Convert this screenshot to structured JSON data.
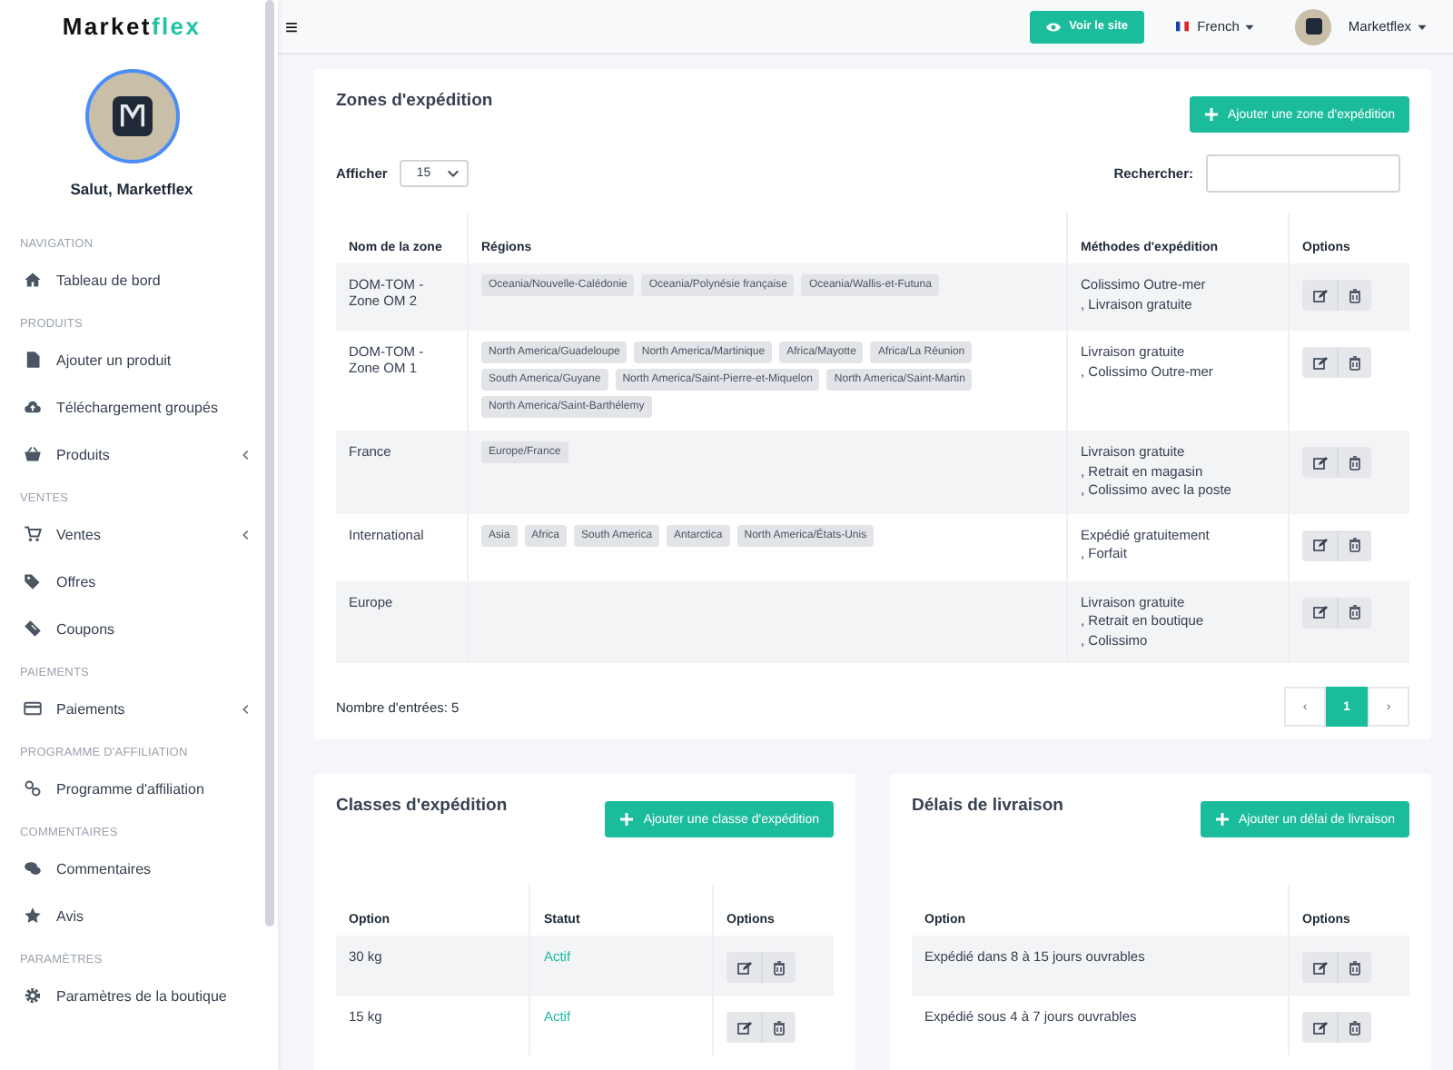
{
  "sidebar": {
    "logo": {
      "dark": "Market",
      "accent": "flex"
    },
    "greeting": "Salut, Marketflex",
    "menu": [
      {
        "kind": "section",
        "label": "NAVIGATION"
      },
      {
        "kind": "item",
        "label": "Tableau de bord",
        "submenu": false
      },
      {
        "kind": "section",
        "label": "PRODUITS"
      },
      {
        "kind": "item",
        "label": "Ajouter un produit",
        "submenu": false
      },
      {
        "kind": "item",
        "label": "Téléchargement groupés",
        "submenu": false
      },
      {
        "kind": "item",
        "label": "Produits",
        "submenu": true
      },
      {
        "kind": "section",
        "label": "VENTES"
      },
      {
        "kind": "item",
        "label": "Ventes",
        "submenu": true
      },
      {
        "kind": "item",
        "label": "Offres",
        "submenu": false
      },
      {
        "kind": "item",
        "label": "Coupons",
        "submenu": false
      },
      {
        "kind": "section",
        "label": "PAIEMENTS"
      },
      {
        "kind": "item",
        "label": "Paiements",
        "submenu": true
      },
      {
        "kind": "section",
        "label": "PROGRAMME D'AFFILIATION"
      },
      {
        "kind": "item",
        "label": "Programme d'affiliation",
        "submenu": false
      },
      {
        "kind": "section",
        "label": "COMMENTAIRES"
      },
      {
        "kind": "item",
        "label": "Commentaires",
        "submenu": false
      },
      {
        "kind": "item",
        "label": "Avis",
        "submenu": false
      },
      {
        "kind": "section",
        "label": "PARAMÈTRES"
      },
      {
        "kind": "item",
        "label": "Paramètres de la boutique",
        "submenu": false
      }
    ]
  },
  "topbar": {
    "menu_glyph": "≡",
    "view_site": "Voir le site",
    "language": "French",
    "user": "Marketflex"
  },
  "zones": {
    "title": "Zones d'expédition",
    "add_button": "Ajouter une zone d'expédition",
    "show_label": "Afficher",
    "page_size": "15",
    "search_label": "Rechercher:",
    "columns": [
      "Nom de la zone",
      "Régions",
      "Méthodes d'expédition",
      "Options"
    ],
    "rows": [
      {
        "name": "DOM-TOM - Zone OM 2",
        "regions": [
          "Oceania/Nouvelle-Calédonie",
          "Oceania/Polynésie française",
          "Oceania/Wallis-et-Futuna"
        ],
        "methods": [
          "Colissimo Outre-mer",
          ", Livraison gratuite"
        ]
      },
      {
        "name": "DOM-TOM - Zone OM 1",
        "regions": [
          "North America/Guadeloupe",
          "North America/Martinique",
          "Africa/Mayotte",
          "Africa/La Réunion",
          "South America/Guyane",
          "North America/Saint-Pierre-et-Miquelon",
          "North America/Saint-Martin",
          "North America/Saint-Barthélemy"
        ],
        "methods": [
          "Livraison gratuite",
          ", Colissimo Outre-mer"
        ]
      },
      {
        "name": "France",
        "regions": [
          "Europe/France"
        ],
        "methods": [
          "Livraison gratuite",
          ", Retrait en magasin",
          ", Colissimo avec la poste"
        ]
      },
      {
        "name": "International",
        "regions": [
          "Asia",
          "Africa",
          "South America",
          "Antarctica",
          "North America/États-Unis"
        ],
        "methods": [
          "Expédié gratuitement",
          ", Forfait"
        ]
      },
      {
        "name": "Europe",
        "regions": [],
        "methods": [
          "Livraison gratuite",
          ", Retrait en boutique",
          ", Colissimo"
        ]
      }
    ],
    "entries": "Nombre d'entrées: 5",
    "pagination": [
      {
        "label": "‹",
        "selected": false
      },
      {
        "label": "1",
        "selected": true
      },
      {
        "label": "›",
        "selected": false
      }
    ]
  },
  "classes": {
    "title": "Classes d'expédition",
    "add_button": "Ajouter une classe d'expédition",
    "columns": [
      "Option",
      "Statut",
      "Options"
    ],
    "rows": [
      {
        "option": "30 kg",
        "status": "Actif"
      },
      {
        "option": "15 kg",
        "status": "Actif"
      }
    ]
  },
  "delays": {
    "title": "Délais de livraison",
    "add_button": "Ajouter un délai de livraison",
    "columns": [
      "Option",
      "Options"
    ],
    "rows": [
      {
        "option": "Expédié dans 8 à 15 jours ouvrables"
      },
      {
        "option": "Expédié sous 4 à 7 jours ouvrables"
      }
    ]
  }
}
